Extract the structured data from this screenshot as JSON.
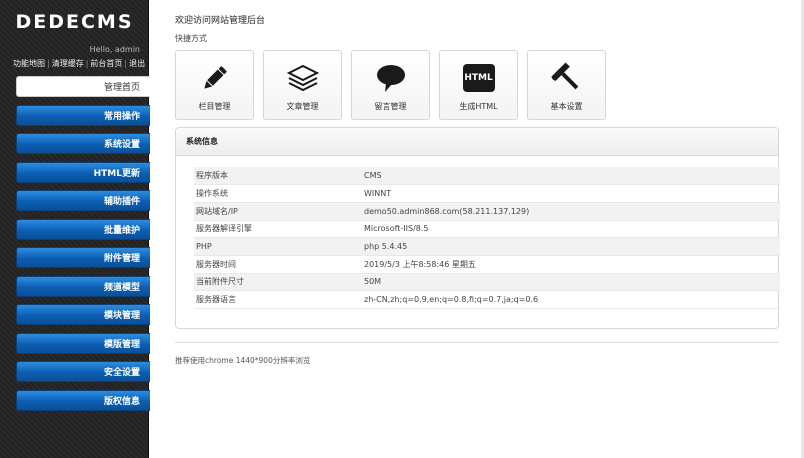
{
  "sidebar": {
    "logo": "DEDECMS",
    "greeting": "Hello, admin",
    "top_links": [
      "功能地图",
      "清理缓存",
      "前台首页",
      "退出"
    ],
    "top_links_sep": "|",
    "nav": [
      {
        "label": "管理首页",
        "active": true
      },
      {
        "label": "常用操作"
      },
      {
        "label": "系统设置"
      },
      {
        "label": "HTML更新"
      },
      {
        "label": "辅助插件"
      },
      {
        "label": "批量维护"
      },
      {
        "label": "附件管理"
      },
      {
        "label": "频道模型"
      },
      {
        "label": "模块管理"
      },
      {
        "label": "模版管理"
      },
      {
        "label": "安全设置"
      },
      {
        "label": "版权信息"
      }
    ],
    "accent_color": "#0b5fb4"
  },
  "main": {
    "welcome": "欢迎访问网站管理后台",
    "quick_label": "快捷方式",
    "quick": [
      {
        "label": "栏目管理",
        "icon": "pencil-icon"
      },
      {
        "label": "文章管理",
        "icon": "stack-icon"
      },
      {
        "label": "留言管理",
        "icon": "speech-bubble-icon"
      },
      {
        "label": "生成HTML",
        "icon": "html-icon",
        "icon_text": "HTML"
      },
      {
        "label": "基本设置",
        "icon": "hammer-icon"
      }
    ],
    "panel": {
      "title": "系统信息",
      "rows": [
        {
          "k": "程序版本",
          "v": "CMS"
        },
        {
          "k": "操作系统",
          "v": "WINNT"
        },
        {
          "k": "网站域名/IP",
          "v": "demo50.admin868.com(58.211.137.129)"
        },
        {
          "k": "服务器解译引擎",
          "v": "Microsoft-IIS/8.5"
        },
        {
          "k": "PHP",
          "v": "php 5.4.45"
        },
        {
          "k": "服务器时间",
          "v": "2019/5/3 上午8:58:46 星期五"
        },
        {
          "k": "当前附件尺寸",
          "v": "50M"
        },
        {
          "k": "服务器语言",
          "v": "zh-CN,zh;q=0.9,en;q=0.8,fi;q=0.7,ja;q=0.6"
        }
      ]
    },
    "footer": "推荐使用chrome 1440*900分辨率浏览"
  }
}
